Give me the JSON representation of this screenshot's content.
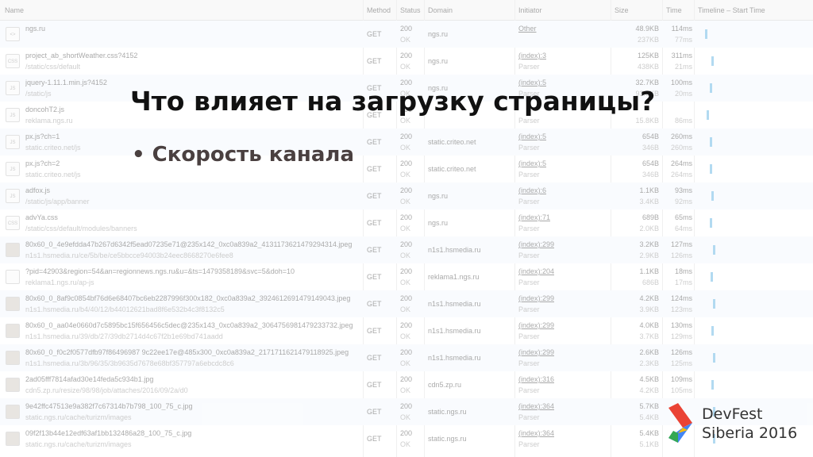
{
  "columns": [
    "Name",
    "Method",
    "Status",
    "Domain",
    "Initiator",
    "Size",
    "Time",
    "Timeline – Start Time"
  ],
  "rows": [
    {
      "icon": "<>",
      "name": "ngs.ru",
      "path": "",
      "method": "GET",
      "status": "200",
      "status_text": "OK",
      "domain": "ngs.ru",
      "initiator": "Other",
      "initiator_sub": "",
      "size": "48.9KB",
      "content": "237KB",
      "time": "114ms",
      "latency": "77ms"
    },
    {
      "icon": "CSS",
      "name": "project_ab_shortWeather.css?4152",
      "path": "/static/css/default",
      "method": "GET",
      "status": "200",
      "status_text": "OK",
      "domain": "ngs.ru",
      "initiator": "(index):3",
      "initiator_sub": "Parser",
      "size": "125KB",
      "content": "438KB",
      "time": "311ms",
      "latency": "21ms"
    },
    {
      "icon": "JS",
      "name": "jquery-1.11.1.min.js?4152",
      "path": "/static/js",
      "method": "GET",
      "status": "200",
      "status_text": "OK",
      "domain": "ngs.ru",
      "initiator": "(index):5",
      "initiator_sub": "Parser",
      "size": "32.7KB",
      "content": "93.6KB",
      "time": "100ms",
      "latency": "20ms"
    },
    {
      "icon": "JS",
      "name": "doncohT2.js",
      "path": "reklama.ngs.ru",
      "method": "GET",
      "status": "200",
      "status_text": "OK",
      "domain": "",
      "initiator": "",
      "initiator_sub": "Parser",
      "size": "",
      "content": "15.8KB",
      "time": "",
      "latency": "86ms"
    },
    {
      "icon": "JS",
      "name": "px.js?ch=1",
      "path": "static.criteo.net/js",
      "method": "GET",
      "status": "200",
      "status_text": "OK",
      "domain": "static.criteo.net",
      "initiator": "(index):5",
      "initiator_sub": "Parser",
      "size": "654B",
      "content": "346B",
      "time": "260ms",
      "latency": "260ms"
    },
    {
      "icon": "JS",
      "name": "px.js?ch=2",
      "path": "static.criteo.net/js",
      "method": "GET",
      "status": "200",
      "status_text": "OK",
      "domain": "static.criteo.net",
      "initiator": "(index):5",
      "initiator_sub": "Parser",
      "size": "654B",
      "content": "346B",
      "time": "264ms",
      "latency": "264ms"
    },
    {
      "icon": "JS",
      "name": "adfox.js",
      "path": "/static/js/app/banner",
      "method": "GET",
      "status": "200",
      "status_text": "OK",
      "domain": "ngs.ru",
      "initiator": "(index):6",
      "initiator_sub": "Parser",
      "size": "1.1KB",
      "content": "3.4KB",
      "time": "93ms",
      "latency": "92ms"
    },
    {
      "icon": "CSS",
      "name": "advYa.css",
      "path": "/static/css/default/modules/banners",
      "method": "GET",
      "status": "200",
      "status_text": "OK",
      "domain": "ngs.ru",
      "initiator": "(index):71",
      "initiator_sub": "Parser",
      "size": "689B",
      "content": "2.0KB",
      "time": "65ms",
      "latency": "64ms"
    },
    {
      "icon": "img",
      "name": "80x60_0_4e9efdda47b267d6342f5ead07235e71@235x142_0xc0a839a2_4131173621479294314.jpeg",
      "path": "n1s1.hsmedia.ru/ce/5b/be/ce5bbcce94003b24eec8668270e6fee8",
      "method": "GET",
      "status": "200",
      "status_text": "OK",
      "domain": "n1s1.hsmedia.ru",
      "initiator": "(index):299",
      "initiator_sub": "Parser",
      "size": "3.2KB",
      "content": "2.9KB",
      "time": "127ms",
      "latency": "126ms"
    },
    {
      "icon": "",
      "name": "?pid=42903&region=54&an=regionnews.ngs.ru&u=&ts=1479358189&svc=5&doh=10",
      "path": "reklama1.ngs.ru/ap-js",
      "method": "GET",
      "status": "200",
      "status_text": "OK",
      "domain": "reklama1.ngs.ru",
      "initiator": "(index):204",
      "initiator_sub": "Parser",
      "size": "1.1KB",
      "content": "686B",
      "time": "18ms",
      "latency": "17ms"
    },
    {
      "icon": "img",
      "name": "80x60_0_8af9c0854bf76d6e68407bc6eb2287996f300x182_0xc0a839a2_3924612691479149043.jpeg",
      "path": "n1s1.hsmedia.ru/b4/40/12/b44012621bad8f6e532b4c3f8132c5",
      "method": "GET",
      "status": "200",
      "status_text": "OK",
      "domain": "n1s1.hsmedia.ru",
      "initiator": "(index):299",
      "initiator_sub": "Parser",
      "size": "4.2KB",
      "content": "3.9KB",
      "time": "124ms",
      "latency": "123ms"
    },
    {
      "icon": "img",
      "name": "80x60_0_aa04e0660d7c5895bc15f656456c5dec@235x143_0xc0a839a2_3064756981479233732.jpeg",
      "path": "n1s1.hsmedia.ru/39/db/27/39db2714d4c67f2b1e69bd741aadd",
      "method": "GET",
      "status": "200",
      "status_text": "OK",
      "domain": "n1s1.hsmedia.ru",
      "initiator": "(index):299",
      "initiator_sub": "Parser",
      "size": "4.0KB",
      "content": "3.7KB",
      "time": "130ms",
      "latency": "129ms"
    },
    {
      "icon": "img",
      "name": "80x60_0_f0c2f0577dfb97f86496987 9c22ee17e@485x300_0xc0a839a2_2171711621479118925.jpeg",
      "path": "n1s1.hsmedia.ru/3b/96/35/3b9635d7678e68bf357797a6ebcdc8c6",
      "method": "GET",
      "status": "200",
      "status_text": "OK",
      "domain": "n1s1.hsmedia.ru",
      "initiator": "(index):299",
      "initiator_sub": "Parser",
      "size": "2.6KB",
      "content": "2.3KB",
      "time": "126ms",
      "latency": "125ms"
    },
    {
      "icon": "img",
      "name": "2ad05fff7814afad30e14feda5c934b1.jpg",
      "path": "cdn5.zp.ru/resize/98/98/job/attaches/2016/09/2a/d0",
      "method": "GET",
      "status": "200",
      "status_text": "OK",
      "domain": "cdn5.zp.ru",
      "initiator": "(index):316",
      "initiator_sub": "Parser",
      "size": "4.5KB",
      "content": "4.2KB",
      "time": "109ms",
      "latency": "105ms"
    },
    {
      "icon": "img",
      "name": "9e42ffc47513e9a382f7c67314b7b798_100_75_c.jpg",
      "path": "static.ngs.ru/cache/turizm/images",
      "method": "GET",
      "status": "200",
      "status_text": "OK",
      "domain": "static.ngs.ru",
      "initiator": "(index):364",
      "initiator_sub": "Parser",
      "size": "5.7KB",
      "content": "5.4KB",
      "time": "",
      "latency": ""
    },
    {
      "icon": "img",
      "name": "09f2f13b44e12edf63af1bb132486a28_100_75_c.jpg",
      "path": "static.ngs.ru/cache/turizm/images",
      "method": "GET",
      "status": "200",
      "status_text": "OK",
      "domain": "static.ngs.ru",
      "initiator": "(index):364",
      "initiator_sub": "Parser",
      "size": "5.4KB",
      "content": "5.1KB",
      "time": "",
      "latency": ""
    }
  ],
  "slide": {
    "title": "Что влияет на загрузку страницы?",
    "bullet": "Скорость канала"
  },
  "logo": {
    "line1": "DevFest",
    "line2": "Siberia 2016"
  },
  "colors": {
    "row_alt": "#f2f7fd",
    "timeline_bar": "#4aa8e0",
    "logo_red": "#ea4335",
    "logo_blue": "#4285f4",
    "logo_green": "#34a853",
    "logo_yellow": "#fbbc05"
  }
}
